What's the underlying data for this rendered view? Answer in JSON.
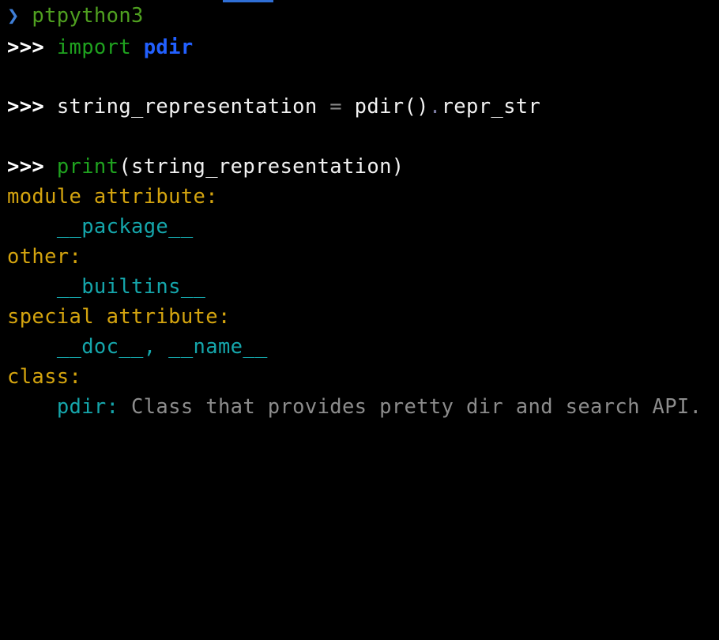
{
  "terminal": {
    "colors": {
      "background": "#000000",
      "prompt": "#ffffff",
      "keyword": "#1fa21f",
      "module": "#2260ff",
      "section_header": "#d4a40f",
      "attribute": "#15a6ab",
      "docstring": "#8c8c8c"
    },
    "shell_line": {
      "arrow": "❯",
      "command": "ptpython3"
    },
    "lines": {
      "l1": {
        "prompt": ">>>",
        "keyword": "import",
        "module": "pdir"
      },
      "l2": {
        "prompt": ">>>",
        "variable": "string_representation",
        "operator": "=",
        "call": "pdir()",
        "dot": ".",
        "attr": "repr_str"
      },
      "l3": {
        "prompt": ">>>",
        "func": "print",
        "args": "(string_representation)"
      }
    },
    "output": {
      "sections": [
        {
          "header": "module attribute:",
          "items": "__package__"
        },
        {
          "header": "other:",
          "items": "__builtins__"
        },
        {
          "header": "special attribute:",
          "items": "__doc__, __name__"
        },
        {
          "header": "class:",
          "items": "pdir:",
          "doc": "Class that provides pretty dir and search API."
        }
      ]
    }
  }
}
